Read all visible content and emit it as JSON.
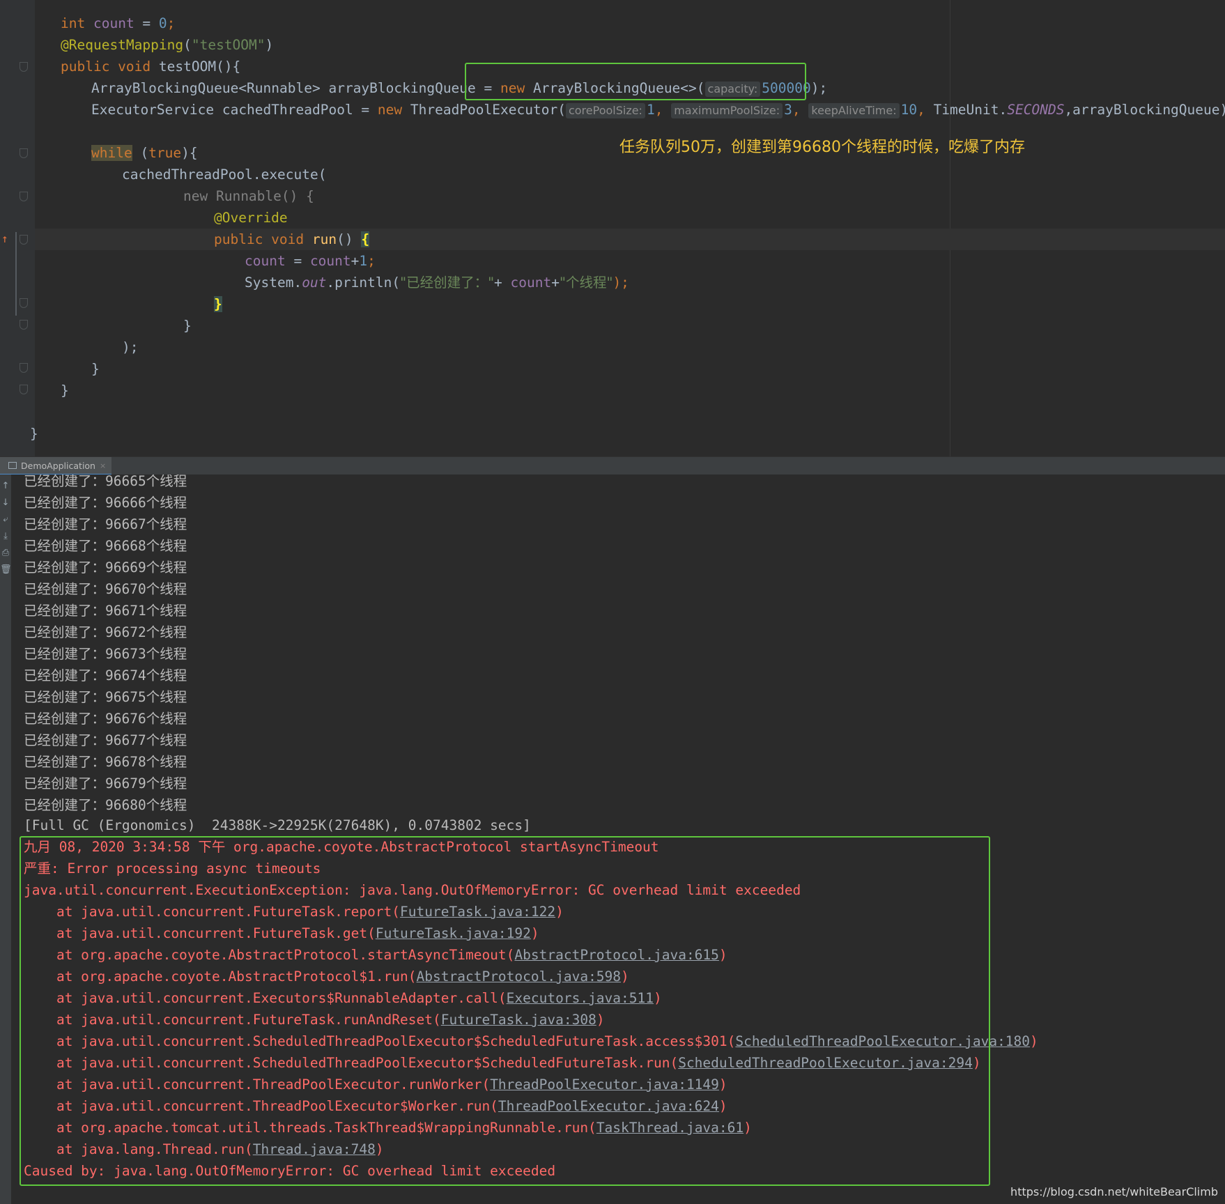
{
  "editor": {
    "note": "任务队列50万，创建到第96680个线程的时候，吃爆了内存",
    "lines": {
      "l1": {
        "kw": "int",
        "field": "count",
        "eq": " = ",
        "num": "0",
        "semi": ";"
      },
      "l2": {
        "ann": "@RequestMapping",
        "open": "(",
        "str": "\"testOOM\"",
        "close": ")"
      },
      "l3": {
        "kw": "public void",
        "name": " testOOM",
        "rest": "(){"
      },
      "l4": {
        "text": "ArrayBlockingQueue<Runnable> arrayBlockingQueue = ",
        "kw": "new",
        "cls": " ArrayBlockingQueue<>(",
        "hint": "capacity:",
        "num": "500000",
        "close": ");"
      },
      "l5": {
        "text": "ExecutorService cachedThreadPool = ",
        "kw": "new",
        "cls": " ThreadPoolExecutor(",
        "hint1": "corePoolSize:",
        "num1": "1",
        "sep1": ", ",
        "hint2": "maximumPoolSize:",
        "num2": "3",
        "sep2": ", ",
        "hint3": "keepAliveTime:",
        "num3": "10",
        "sep3": ", ",
        "tu": "TimeUnit.",
        "sfield": "SECONDS",
        "tail": ",arrayBlockingQueue);"
      },
      "l6": {
        "kw": "while",
        "mid": " (",
        "kw2": "true",
        "rest": "){"
      },
      "l7": {
        "text": "cachedThreadPool.execute("
      },
      "l8": {
        "kw": "new",
        "text": " Runnable() {"
      },
      "l9": {
        "ann": "@Override"
      },
      "l10": {
        "kw": "public void",
        "fn": " run",
        "paren": "() ",
        "brace": "{"
      },
      "l11": {
        "field": "count",
        "eq": " = ",
        "field2": "count",
        "plus": "+",
        "num": "1",
        "semi": ";"
      },
      "l12": {
        "text": "System.",
        "sfield": "out",
        "text2": ".println(",
        "str": "\"已经创建了：\"",
        "plus": "+ ",
        "field": "count",
        "plus2": "+",
        "str2": "\"个线程\"",
        "close": ");"
      },
      "l13": {
        "brace": "}"
      },
      "l14": {
        "text": "}"
      },
      "l15": {
        "text": ");"
      },
      "l16": {
        "text": "}"
      },
      "l17": {
        "text": "}"
      },
      "l18": {
        "text": "}"
      }
    }
  },
  "run_panel": {
    "tab_label": "DemoApplication",
    "tab_close": "×",
    "side_icons": [
      "↑",
      "↓",
      "⤶",
      "⤓",
      "⎙",
      "🗑"
    ]
  },
  "console": {
    "created_prefix": "已经创建了：",
    "created_suffix": "个线程",
    "created_counts": [
      "96665",
      "96666",
      "96667",
      "96668",
      "96669",
      "96670",
      "96671",
      "96672",
      "96673",
      "96674",
      "96675",
      "96676",
      "96677",
      "96678",
      "96679",
      "96680"
    ],
    "gc_line": "[Full GC (Ergonomics)  24388K->22925K(27648K), 0.0743802 secs]",
    "error_header": "九月 08, 2020 3:34:58 下午 org.apache.coyote.AbstractProtocol startAsyncTimeout",
    "error_severity": "严重: Error processing async timeouts",
    "exception": "java.util.concurrent.ExecutionException: java.lang.OutOfMemoryError: GC overhead limit exceeded",
    "stack": [
      {
        "method": "    at java.util.concurrent.FutureTask.report(",
        "link": "FutureTask.java:122",
        "end": ")"
      },
      {
        "method": "    at java.util.concurrent.FutureTask.get(",
        "link": "FutureTask.java:192",
        "end": ")"
      },
      {
        "method": "    at org.apache.coyote.AbstractProtocol.startAsyncTimeout(",
        "link": "AbstractProtocol.java:615",
        "end": ")"
      },
      {
        "method": "    at org.apache.coyote.AbstractProtocol$1.run(",
        "link": "AbstractProtocol.java:598",
        "end": ")"
      },
      {
        "method": "    at java.util.concurrent.Executors$RunnableAdapter.call(",
        "link": "Executors.java:511",
        "end": ")"
      },
      {
        "method": "    at java.util.concurrent.FutureTask.runAndReset(",
        "link": "FutureTask.java:308",
        "end": ")"
      },
      {
        "method": "    at java.util.concurrent.ScheduledThreadPoolExecutor$ScheduledFutureTask.access$301(",
        "link": "ScheduledThreadPoolExecutor.java:180",
        "end": ")"
      },
      {
        "method": "    at java.util.concurrent.ScheduledThreadPoolExecutor$ScheduledFutureTask.run(",
        "link": "ScheduledThreadPoolExecutor.java:294",
        "end": ")"
      },
      {
        "method": "    at java.util.concurrent.ThreadPoolExecutor.runWorker(",
        "link": "ThreadPoolExecutor.java:1149",
        "end": ")"
      },
      {
        "method": "    at java.util.concurrent.ThreadPoolExecutor$Worker.run(",
        "link": "ThreadPoolExecutor.java:624",
        "end": ")"
      },
      {
        "method": "    at org.apache.tomcat.util.threads.TaskThread$WrappingRunnable.run(",
        "link": "TaskThread.java:61",
        "end": ")"
      },
      {
        "method": "    at java.lang.Thread.run(",
        "link": "Thread.java:748",
        "end": ")"
      }
    ],
    "caused_by": "Caused by: java.lang.OutOfMemoryError: GC overhead limit exceeded"
  },
  "watermark": "https://blog.csdn.net/whiteBearClimb"
}
